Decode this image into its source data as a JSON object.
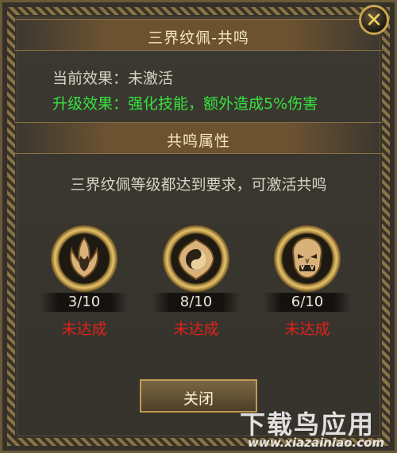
{
  "window": {
    "title": "三界纹佩-共鸣"
  },
  "effects": {
    "current": "当前效果：未激活",
    "upgrade": "升级效果：强化技能，额外造成5%伤害"
  },
  "section": {
    "title": "共鸣属性"
  },
  "hint": "三界纹佩等级都达到要求，可激活共鸣",
  "badges": [
    {
      "icon": "flame-crest-icon",
      "count": "3/10",
      "status": "未达成"
    },
    {
      "icon": "yin-yang-crest-icon",
      "count": "8/10",
      "status": "未达成"
    },
    {
      "icon": "demon-mask-icon",
      "count": "6/10",
      "status": "未达成"
    }
  ],
  "buttons": {
    "close_label": "关闭"
  },
  "watermark": {
    "main": "下载鸟应用",
    "sub": "www.xiazainiao.com"
  },
  "colors": {
    "upgrade_text": "#37e23f",
    "status_text": "#e2211a",
    "accent_gold": "#c9a54c"
  }
}
